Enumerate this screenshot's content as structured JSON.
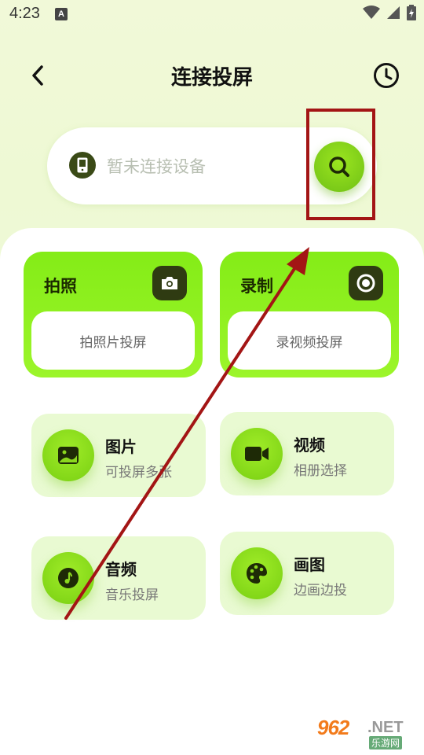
{
  "status_bar": {
    "time": "4:23",
    "notification_icon_letter": "A",
    "icons": [
      "wifi-icon",
      "signal-icon",
      "battery-icon"
    ]
  },
  "header": {
    "title": "连接投屏",
    "back_icon": "chevron-left-icon",
    "history_icon": "clock-icon"
  },
  "device_bar": {
    "placeholder": "暂未连接设备",
    "device_icon": "phone-icon",
    "search_icon": "search-icon"
  },
  "big_cards": {
    "photo": {
      "title": "拍照",
      "action": "拍照片投屏",
      "icon": "camera-icon"
    },
    "record": {
      "title": "录制",
      "action": "录视频投屏",
      "icon": "record-icon"
    }
  },
  "small_cards": {
    "picture": {
      "title": "图片",
      "subtitle": "可投屏多张",
      "icon": "image-icon"
    },
    "video": {
      "title": "视频",
      "subtitle": "相册选择",
      "icon": "video-camera-icon"
    },
    "audio": {
      "title": "音频",
      "subtitle": "音乐投屏",
      "icon": "music-note-icon"
    },
    "draw": {
      "title": "画图",
      "subtitle": "边画边投",
      "icon": "palette-icon"
    }
  },
  "watermark": {
    "number": "962",
    "suffix": ".NET",
    "chinese": "乐游网"
  },
  "colors": {
    "accent_green": "#84ec17",
    "dark_green": "#2f3b12",
    "annotation_red": "#a31515",
    "card_light": "#e9fad2"
  }
}
